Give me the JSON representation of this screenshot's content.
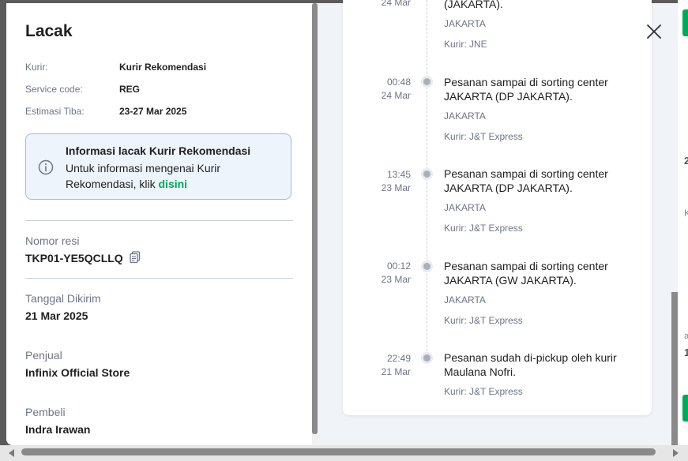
{
  "title": "Lacak",
  "info": {
    "kurir_label": "Kurir:",
    "kurir_value": "Kurir Rekomendasi",
    "service_label": "Service code:",
    "service_value": "REG",
    "estimasi_label": "Estimasi Tiba:",
    "estimasi_value": "23-27 Mar 2025"
  },
  "notice": {
    "title": "Informasi lacak Kurir Rekomendasi",
    "body": "Untuk informasi mengenai Kurir Rekomendasi, klik",
    "link": "disini"
  },
  "fields": {
    "resi_label": "Nomor resi",
    "resi_value": "TKP01-YE5QCLLQ",
    "dikirim_label": "Tanggal Dikirim",
    "dikirim_value": "21 Mar 2025",
    "penjual_label": "Penjual",
    "penjual_value": "Infinix Official Store",
    "pembeli_label": "Pembeli",
    "pembeli_value": "Indra Irawan"
  },
  "timeline": {
    "partial": {
      "date": "24 Mar",
      "desc": "(JAKARTA).",
      "location": "JAKARTA",
      "courier": "Kurir: JNE"
    },
    "events": [
      {
        "time": "00:48",
        "date": "24 Mar",
        "desc": "Pesanan sampai di sorting center JAKARTA (DP JAKARTA).",
        "location": "JAKARTA",
        "courier": "Kurir: J&T Express"
      },
      {
        "time": "13:45",
        "date": "23 Mar",
        "desc": "Pesanan sampai di sorting center JAKARTA (DP JAKARTA).",
        "location": "JAKARTA",
        "courier": "Kurir: J&T Express"
      },
      {
        "time": "00:12",
        "date": "23 Mar",
        "desc": "Pesanan sampai di sorting center JAKARTA (GW JAKARTA).",
        "location": "JAKARTA",
        "courier": "Kurir: J&T Express"
      },
      {
        "time": "22:49",
        "date": "21 Mar",
        "desc": "Pesanan sudah di-pickup oleh kurir Maulana Nofri.",
        "location": "",
        "courier": "Kurir: J&T Express"
      }
    ]
  },
  "colors": {
    "accent_green": "#00aa5b",
    "notice_bg": "#edf4fc",
    "notice_border": "#9bbde6",
    "muted_text": "#6d7588"
  }
}
